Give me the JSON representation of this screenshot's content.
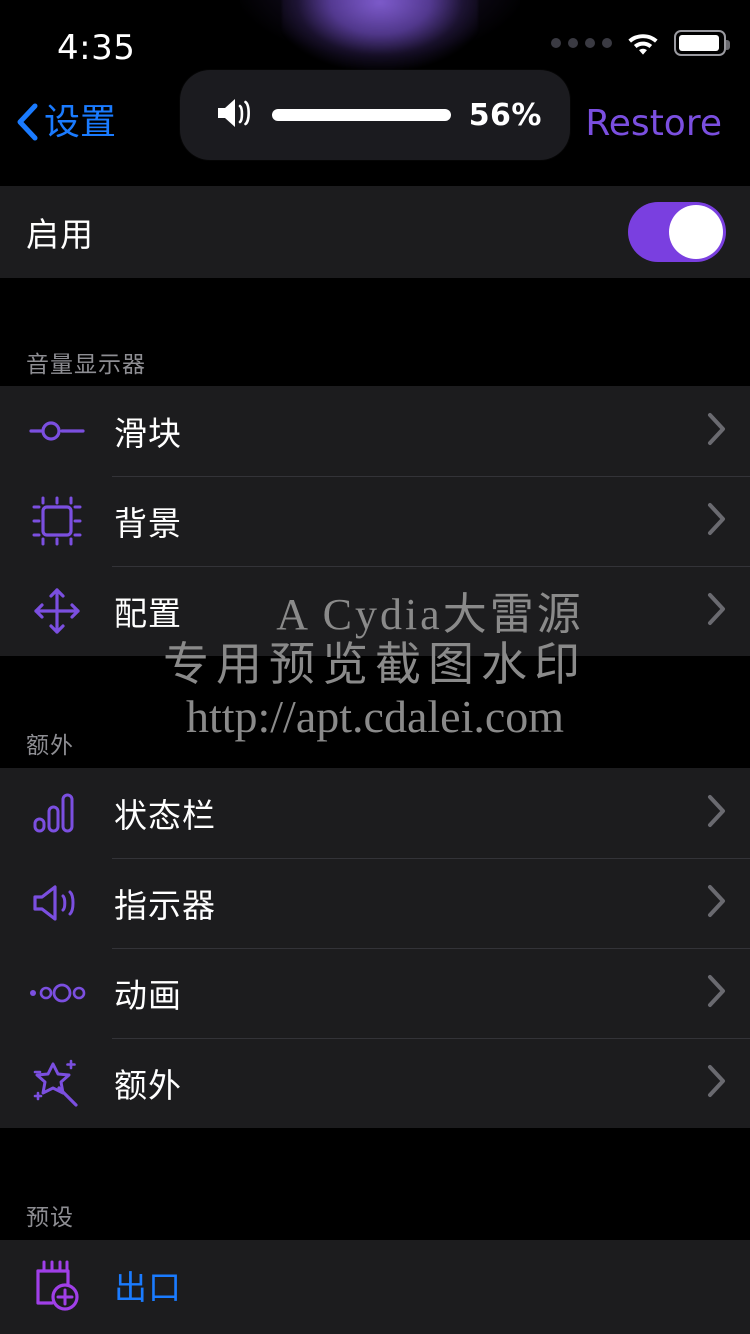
{
  "statusbar": {
    "time": "4:35",
    "signal_icon": "signal-dots-icon",
    "wifi_icon": "wifi-icon",
    "battery_icon": "battery-icon"
  },
  "volume_hud": {
    "speaker_icon": "speaker-waves-icon",
    "percent_label": "56%",
    "percent_value": 56,
    "fill_color": "#7c4ddb",
    "track_color": "#ffffff"
  },
  "navbar": {
    "back_icon": "chevron-left-icon",
    "back_label": "设置",
    "back_color": "#1a7bff",
    "restore_label": "Restore",
    "restore_color": "#7b4fe0"
  },
  "enable_row": {
    "label": "启用",
    "switch_on": true,
    "switch_color": "#7a3fe0"
  },
  "sections": [
    {
      "header": "音量显示器",
      "rows": [
        {
          "icon": "slider-icon",
          "label": "滑块",
          "accessory": "chevron-right-icon"
        },
        {
          "icon": "frame-dashed-icon",
          "label": "背景",
          "accessory": "chevron-right-icon"
        },
        {
          "icon": "move-arrows-icon",
          "label": "配置",
          "accessory": "chevron-right-icon"
        }
      ]
    },
    {
      "header": "额外",
      "rows": [
        {
          "icon": "bar-chart-icon",
          "label": "状态栏",
          "accessory": "chevron-right-icon"
        },
        {
          "icon": "speaker-waves-icon",
          "label": "指示器",
          "accessory": "chevron-right-icon"
        },
        {
          "icon": "dots-animation-icon",
          "label": "动画",
          "accessory": "chevron-right-icon"
        },
        {
          "icon": "magic-wand-icon",
          "label": "额外",
          "accessory": "chevron-right-icon"
        }
      ]
    },
    {
      "header": "预设",
      "rows": [
        {
          "icon": "note-add-icon",
          "label": "出口",
          "accessory": "",
          "link": true
        }
      ]
    }
  ],
  "watermark": {
    "line1": "A Cydia大雷源",
    "line2": "专用预览截图水印",
    "line3": "http://apt.cdalei.com",
    "color": "#8a8a8a"
  },
  "theme": {
    "background": "#000000",
    "row_background": "#1c1c1e",
    "separator": "#333338",
    "label_color": "#ffffff",
    "header_color": "#8e8e93",
    "accent_purple": "#7b4fe0",
    "accent_blue": "#1a7bff",
    "chevron_color": "#6a6a70"
  }
}
